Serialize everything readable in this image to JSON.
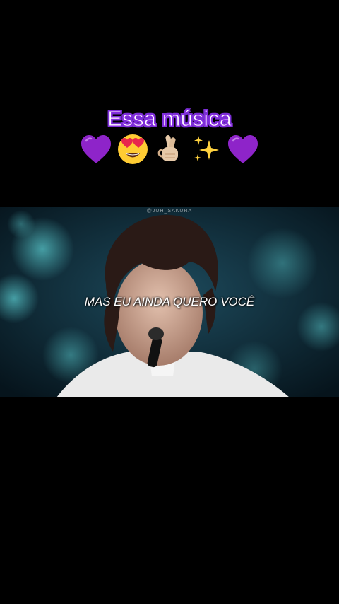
{
  "caption": {
    "title": "Essa música",
    "emojis": [
      "purple-heart-icon",
      "heart-eyes-face-icon",
      "crossed-fingers-icon",
      "sparkles-icon",
      "purple-heart-icon"
    ]
  },
  "video": {
    "watermark": "@JUH_SAKURA",
    "subtitle": "MAS EU AINDA QUERO VOCÊ"
  },
  "colors": {
    "background": "#000000",
    "caption_outline": "#7b2fd6",
    "heart": "#8e24c9",
    "face": "#ffcc33",
    "sparkle": "#ffd23f"
  }
}
